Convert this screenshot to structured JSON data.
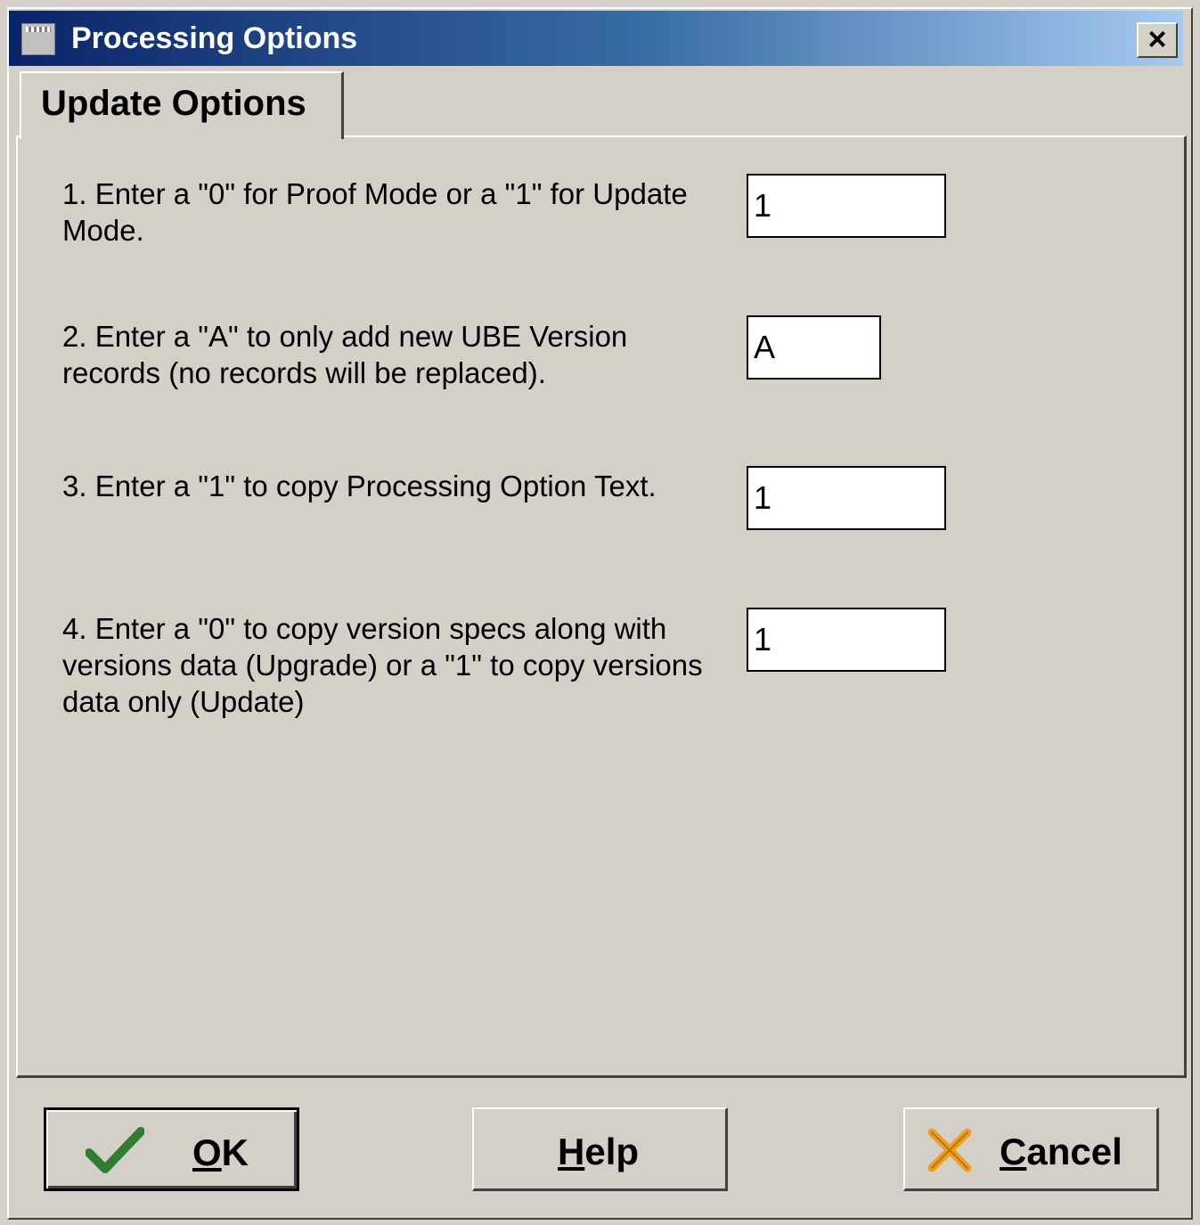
{
  "window": {
    "title": "Processing Options",
    "close_label": "×"
  },
  "tabs": [
    {
      "label": "Update Options"
    }
  ],
  "options": [
    {
      "label": "1. Enter a \"0\" for Proof Mode or a \"1\" for Update Mode.",
      "value": "1"
    },
    {
      "label": "2. Enter a \"A\" to only add new UBE Version records (no records will be replaced).",
      "value": "A"
    },
    {
      "label": "3. Enter a \"1\" to copy Processing Option Text.",
      "value": "1"
    },
    {
      "label": "4. Enter a \"0\" to copy version specs along with versions data (Upgrade) or a \"1\" to copy versions data only (Update)",
      "value": "1"
    }
  ],
  "buttons": {
    "ok_label": "OK",
    "help_label": "Help",
    "cancel_label": "Cancel"
  },
  "icons": {
    "ok": "checkmark-icon",
    "cancel": "cancel-x-icon"
  },
  "colors": {
    "titlebar_start": "#0a246a",
    "titlebar_end": "#a6caf0",
    "check_green": "#2e7d32",
    "cancel_orange": "#e8a020"
  }
}
